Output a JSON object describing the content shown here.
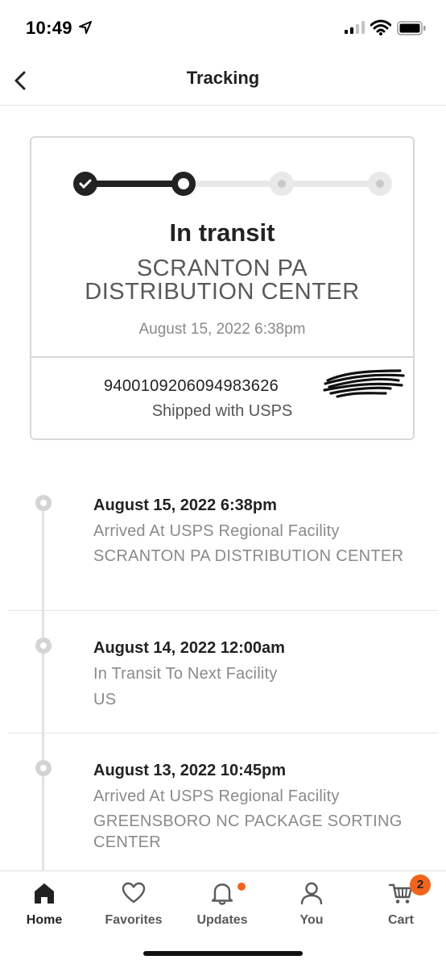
{
  "status_bar": {
    "time": "10:49"
  },
  "header": {
    "title": "Tracking"
  },
  "card": {
    "progress_step": 2,
    "progress_total": 4,
    "status": "In transit",
    "location": "SCRANTON PA DISTRIBUTION CENTER",
    "date": "August 15, 2022 6:38pm",
    "tracking_number": "9400109206094983626",
    "carrier": "Shipped with USPS"
  },
  "events": [
    {
      "date": "August 15, 2022 6:38pm",
      "description": "Arrived At USPS Regional Facility",
      "location": "SCRANTON PA DISTRIBUTION CENTER"
    },
    {
      "date": "August 14, 2022 12:00am",
      "description": "In Transit To Next Facility",
      "location": "US"
    },
    {
      "date": "August 13, 2022 10:45pm",
      "description": "Arrived At USPS Regional Facility",
      "location": "GREENSBORO NC PACKAGE SORTING CENTER"
    }
  ],
  "tabs": [
    {
      "label": "Home",
      "icon": "home-icon",
      "active": true
    },
    {
      "label": "Favorites",
      "icon": "heart-icon"
    },
    {
      "label": "Updates",
      "icon": "bell-icon"
    },
    {
      "label": "You",
      "icon": "person-icon"
    },
    {
      "label": "Cart",
      "icon": "cart-icon",
      "badge": "2"
    }
  ],
  "colors": {
    "accent": "#f1641e",
    "progress_done": "#222222",
    "progress_pending": "#e9e9e9"
  }
}
